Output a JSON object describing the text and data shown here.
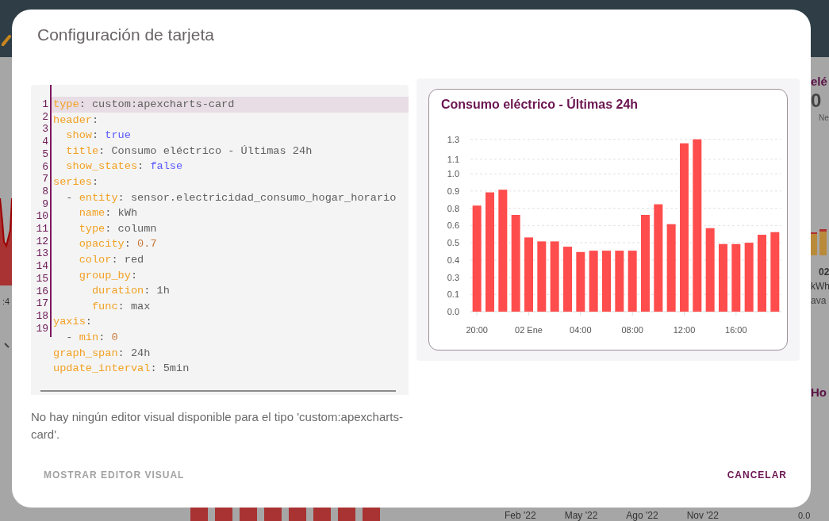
{
  "background": {
    "left_panel": {
      "time_label": ":4"
    },
    "right_panel": {
      "title": "elé",
      "value": "0",
      "caption": "Ne",
      "date": "02",
      "unit": "kWh",
      "label": "ava",
      "title_2": "Ho"
    },
    "bottom_axis": {
      "labels": [
        "Feb '22",
        "May '22",
        "Ago '22",
        "Nov '22"
      ],
      "value": "0.0"
    }
  },
  "dialog": {
    "title": "Configuración de tarjeta",
    "editor": {
      "line_numbers": [
        "1",
        "2",
        "3",
        "4",
        "5",
        "6",
        "7",
        "8",
        "9",
        "10",
        "11",
        "12",
        "13",
        "14",
        "15",
        "16",
        "17",
        "18",
        "19"
      ],
      "lines": [
        {
          "active": true,
          "segments": [
            {
              "kind": "key",
              "text": "type"
            },
            {
              "kind": "text",
              "text": ": custom:apexcharts-card"
            }
          ]
        },
        {
          "active": false,
          "segments": [
            {
              "kind": "key",
              "text": "header"
            },
            {
              "kind": "text",
              "text": ":"
            }
          ]
        },
        {
          "active": false,
          "segments": [
            {
              "kind": "key",
              "text": "  show"
            },
            {
              "kind": "text",
              "text": ": "
            },
            {
              "kind": "bool",
              "text": "true"
            }
          ]
        },
        {
          "active": false,
          "segments": [
            {
              "kind": "key",
              "text": "  title"
            },
            {
              "kind": "text",
              "text": ": Consumo eléctrico - Últimas 24h"
            }
          ]
        },
        {
          "active": false,
          "segments": [
            {
              "kind": "key",
              "text": "  show_states"
            },
            {
              "kind": "text",
              "text": ": "
            },
            {
              "kind": "bool",
              "text": "false"
            }
          ]
        },
        {
          "active": false,
          "segments": [
            {
              "kind": "key",
              "text": "series"
            },
            {
              "kind": "text",
              "text": ":"
            }
          ]
        },
        {
          "active": false,
          "segments": [
            {
              "kind": "text",
              "text": "  - "
            },
            {
              "kind": "key",
              "text": "entity"
            },
            {
              "kind": "text",
              "text": ": sensor.electricidad_consumo_hogar_horario"
            }
          ]
        },
        {
          "active": false,
          "segments": [
            {
              "kind": "key",
              "text": "    name"
            },
            {
              "kind": "text",
              "text": ": kWh"
            }
          ]
        },
        {
          "active": false,
          "segments": [
            {
              "kind": "key",
              "text": "    type"
            },
            {
              "kind": "text",
              "text": ": column"
            }
          ]
        },
        {
          "active": false,
          "segments": [
            {
              "kind": "key",
              "text": "    opacity"
            },
            {
              "kind": "text",
              "text": ": "
            },
            {
              "kind": "number",
              "text": "0.7"
            }
          ]
        },
        {
          "active": false,
          "segments": [
            {
              "kind": "key",
              "text": "    color"
            },
            {
              "kind": "text",
              "text": ": red"
            }
          ]
        },
        {
          "active": false,
          "segments": [
            {
              "kind": "key",
              "text": "    group_by"
            },
            {
              "kind": "text",
              "text": ":"
            }
          ]
        },
        {
          "active": false,
          "segments": [
            {
              "kind": "key",
              "text": "      duration"
            },
            {
              "kind": "text",
              "text": ": 1h"
            }
          ]
        },
        {
          "active": false,
          "segments": [
            {
              "kind": "key",
              "text": "      func"
            },
            {
              "kind": "text",
              "text": ": max"
            }
          ]
        },
        {
          "active": false,
          "segments": [
            {
              "kind": "key",
              "text": "yaxis"
            },
            {
              "kind": "text",
              "text": ":"
            }
          ]
        },
        {
          "active": false,
          "segments": [
            {
              "kind": "text",
              "text": "  - "
            },
            {
              "kind": "key",
              "text": "min"
            },
            {
              "kind": "text",
              "text": ": "
            },
            {
              "kind": "number",
              "text": "0"
            }
          ]
        },
        {
          "active": false,
          "segments": [
            {
              "kind": "key",
              "text": "graph_span"
            },
            {
              "kind": "text",
              "text": ": 24h"
            }
          ]
        },
        {
          "active": false,
          "segments": [
            {
              "kind": "key",
              "text": "update_interval"
            },
            {
              "kind": "text",
              "text": ": 5min"
            }
          ]
        }
      ]
    },
    "note": "No hay ningún editor visual disponible para el tipo 'custom:apexcharts-card'.",
    "preview": {
      "chart_data": {
        "type": "bar",
        "title": "Consumo eléctrico - Últimas 24h",
        "categories": [
          "20:00",
          null,
          null,
          null,
          "02 Ene",
          null,
          null,
          null,
          "04:00",
          null,
          null,
          null,
          "08:00",
          null,
          null,
          null,
          "12:00",
          null,
          null,
          null,
          "16:00",
          null,
          null,
          null
        ],
        "series": [
          {
            "color": "#ff4c4c",
            "values": [
              0.8,
              0.9,
              0.92,
              0.73,
              0.56,
              0.53,
              0.53,
              0.49,
              0.45,
              0.46,
              0.46,
              0.46,
              0.46,
              0.73,
              0.81,
              0.66,
              1.27,
              1.3,
              0.63,
              0.51,
              0.51,
              0.52,
              0.58,
              0.6
            ]
          }
        ],
        "ylim": [
          0,
          1.3
        ],
        "grid": true,
        "yticks": [
          {
            "value": 0,
            "label": "0.0"
          },
          {
            "value": 0.13,
            "label": "0.1"
          },
          {
            "value": 0.26,
            "label": "0.3"
          },
          {
            "value": 0.39,
            "label": "0.4"
          },
          {
            "value": 0.52,
            "label": "0.5"
          },
          {
            "value": 0.65,
            "label": "0.6"
          },
          {
            "value": 0.78,
            "label": "0.8"
          },
          {
            "value": 0.91,
            "label": "0.9"
          },
          {
            "value": 1.04,
            "label": "1.0"
          },
          {
            "value": 1.15,
            "label": "1.1"
          },
          {
            "value": 1.3,
            "label": "1.3"
          }
        ]
      }
    },
    "buttons": [
      {
        "label": "MOSTRAR EDITOR VISUAL",
        "disabled": true
      },
      {
        "label": "CANCELAR",
        "disabled": false
      }
    ]
  }
}
